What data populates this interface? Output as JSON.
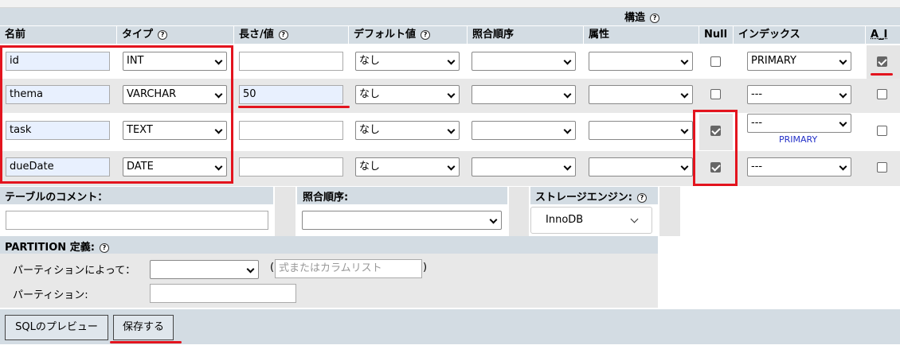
{
  "section_title": "構造",
  "columns": {
    "name": "名前",
    "type": "タイプ",
    "length": "長さ/値",
    "default": "デフォルト値",
    "collation": "照合順序",
    "attributes": "属性",
    "null": "Null",
    "index": "インデックス",
    "ai": "A_I"
  },
  "rows": [
    {
      "name": "id",
      "type": "INT",
      "length": "",
      "default": "なし",
      "collation": "",
      "attributes": "",
      "null": false,
      "index": "PRIMARY",
      "index_note": "",
      "ai": true
    },
    {
      "name": "thema",
      "type": "VARCHAR",
      "length": "50",
      "default": "なし",
      "collation": "",
      "attributes": "",
      "null": false,
      "index": "---",
      "index_note": "",
      "ai": false
    },
    {
      "name": "task",
      "type": "TEXT",
      "length": "",
      "default": "なし",
      "collation": "",
      "attributes": "",
      "null": true,
      "index": "---",
      "index_note": "PRIMARY",
      "ai": false
    },
    {
      "name": "dueDate",
      "type": "DATE",
      "length": "",
      "default": "なし",
      "collation": "",
      "attributes": "",
      "null": true,
      "index": "---",
      "index_note": "",
      "ai": false
    }
  ],
  "table_options": {
    "comment_label": "テーブルのコメント：",
    "comment_value": "",
    "collation_label": "照合順序:",
    "collation_value": "",
    "storage_label": "ストレージエンジン:",
    "storage_value": "InnoDB"
  },
  "partition": {
    "title": "PARTITION 定義:",
    "by_label": "パーティションによって：",
    "by_value": "",
    "expr_open": "(",
    "expr_placeholder": "式またはカラムリスト",
    "expr_close": ")",
    "partitions_label": "パーティション:",
    "partitions_value": ""
  },
  "buttons": {
    "preview": "SQLのプレビュー",
    "save": "保存する"
  },
  "help_icon": "?",
  "colors": {
    "header_bg": "#d3dce3",
    "highlight_red": "#e3141e",
    "primary_link": "#2330c8"
  }
}
